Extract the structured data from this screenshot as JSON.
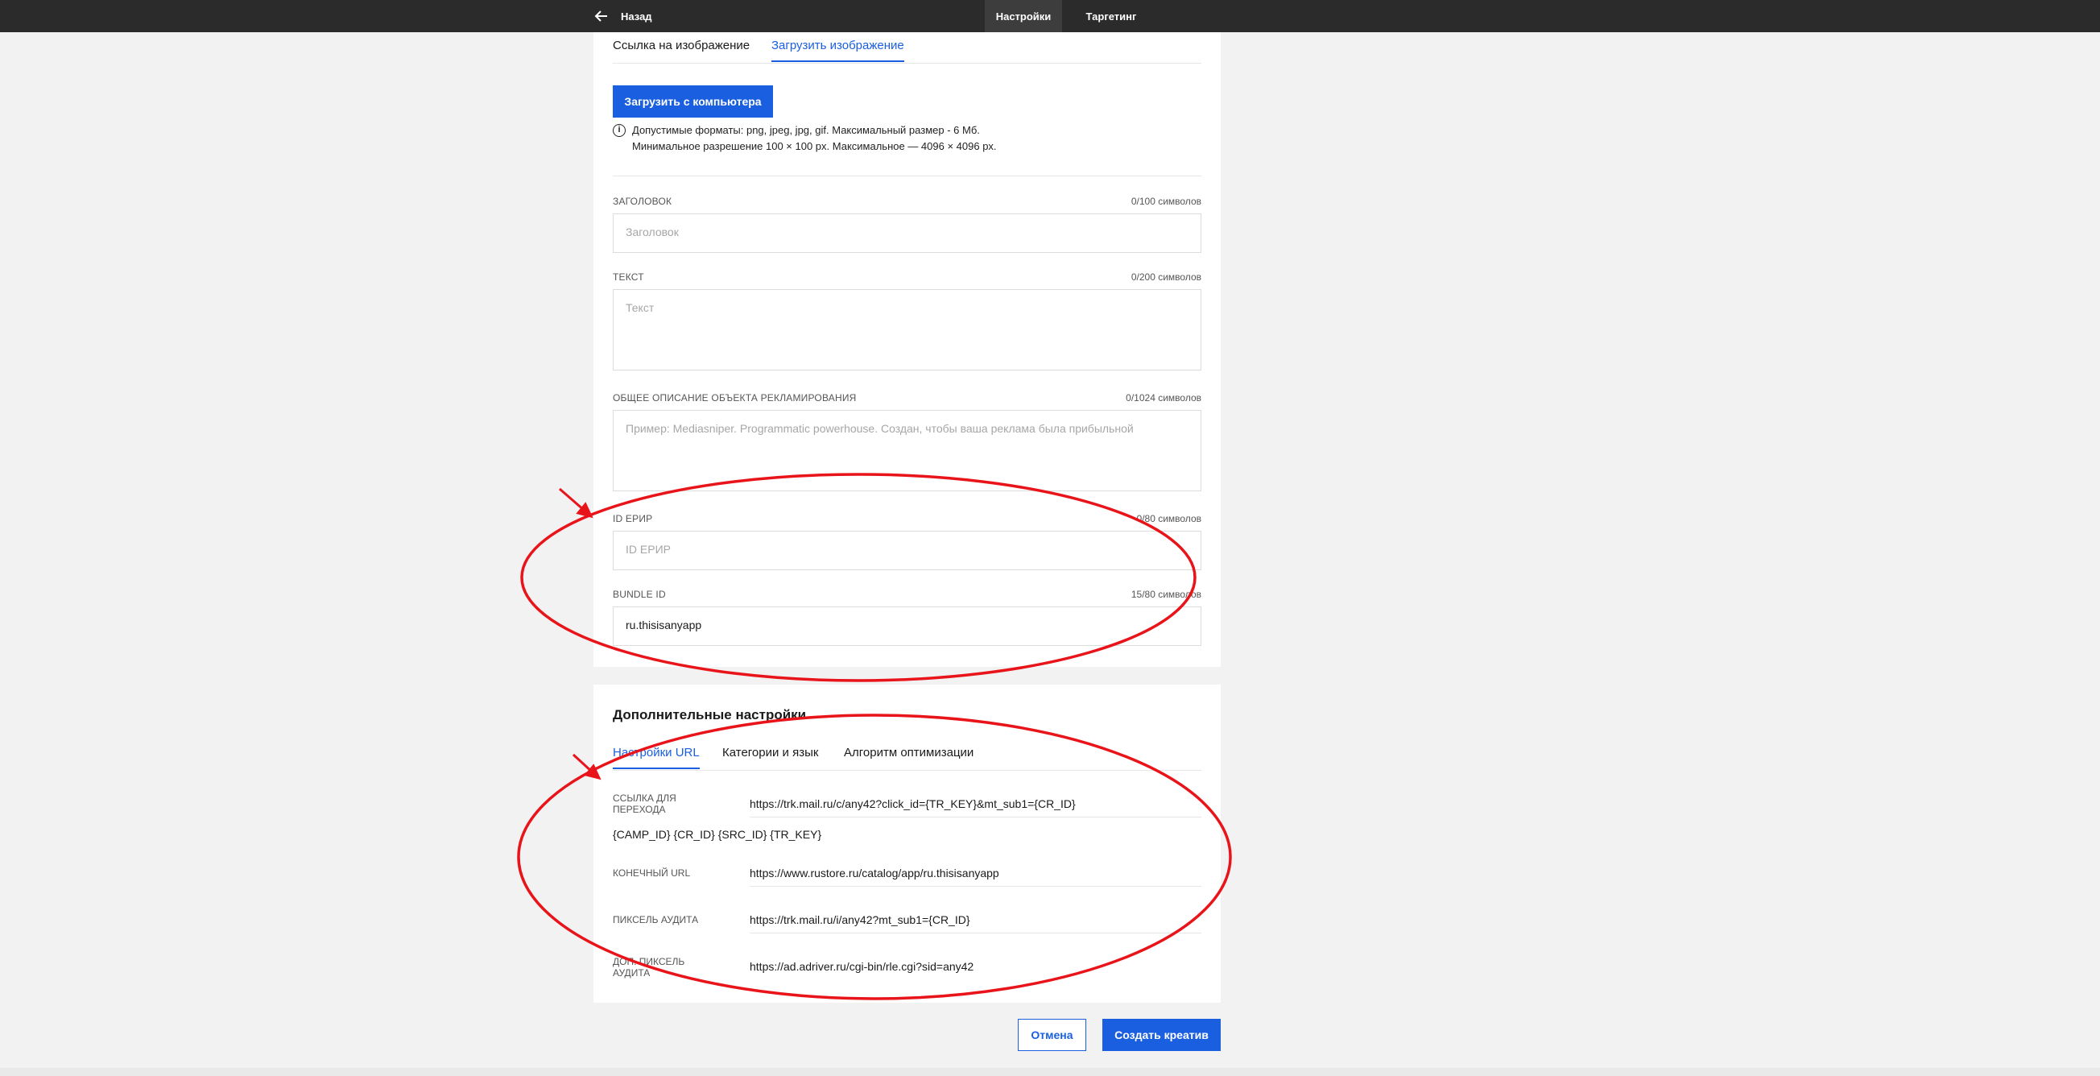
{
  "topbar": {
    "back_label": "Назад",
    "tabs": [
      {
        "label": "Настройки",
        "active": true
      },
      {
        "label": "Таргетинг",
        "active": false
      }
    ]
  },
  "image_section": {
    "tabs": [
      {
        "label": "Ссылка на изображение",
        "active": false
      },
      {
        "label": "Загрузить изображение",
        "active": true
      }
    ],
    "upload_button": "Загрузить с компьютера",
    "info_line1": "Допустимые форматы: png, jpeg, jpg, gif. Максимальный размер - 6 Мб.",
    "info_line2": "Минимальное разрешение 100 × 100 px. Максимальное — 4096 × 4096 px."
  },
  "fields": {
    "title": {
      "label": "Заголовок",
      "count": "0/100 символов",
      "placeholder": "Заголовок",
      "value": ""
    },
    "text": {
      "label": "Текст",
      "count": "0/200 символов",
      "placeholder": "Текст",
      "value": ""
    },
    "description": {
      "label": "Общее описание объекта рекламирования",
      "count": "0/1024 символов",
      "placeholder": "Пример: Mediasniper. Programmatic powerhouse. Создан, чтобы ваша реклама была прибыльной",
      "value": ""
    },
    "erid": {
      "label": "ID ЕРИР",
      "count": "0/80 символов",
      "placeholder": "ID ЕРИР",
      "value": ""
    },
    "bundle": {
      "label": "Bundle ID",
      "count": "15/80 символов",
      "value": "ru.thisisanyapp"
    }
  },
  "advanced": {
    "title": "Дополнительные настройки",
    "tabs": [
      {
        "label": "Настройки URL",
        "active": true
      },
      {
        "label": "Категории и язык",
        "active": false
      },
      {
        "label": "Алгоритм оптимизации",
        "active": false
      }
    ],
    "click_url": {
      "label": "Ссылка для перехода",
      "value": "https://trk.mail.ru/c/any42?click_id={TR_KEY}&mt_sub1={CR_ID}"
    },
    "macros": "{CAMP_ID} {CR_ID} {SRC_ID} {TR_KEY}",
    "final_url": {
      "label": "Конечный URL",
      "value": "https://www.rustore.ru/catalog/app/ru.thisisanyapp"
    },
    "audit_pixel": {
      "label": "Пиксель аудита",
      "value": "https://trk.mail.ru/i/any42?mt_sub1={CR_ID}"
    },
    "extra_audit_pixel": {
      "label": "Доп. пиксель аудита",
      "value": "https://ad.adriver.ru/cgi-bin/rle.cgi?sid=any42"
    }
  },
  "footer": {
    "cancel_label": "Отмена",
    "create_label": "Создать креатив"
  },
  "colors": {
    "accent": "#1a5fe0",
    "annotation": "#e8141a",
    "topbar": "#2b2b2b"
  }
}
